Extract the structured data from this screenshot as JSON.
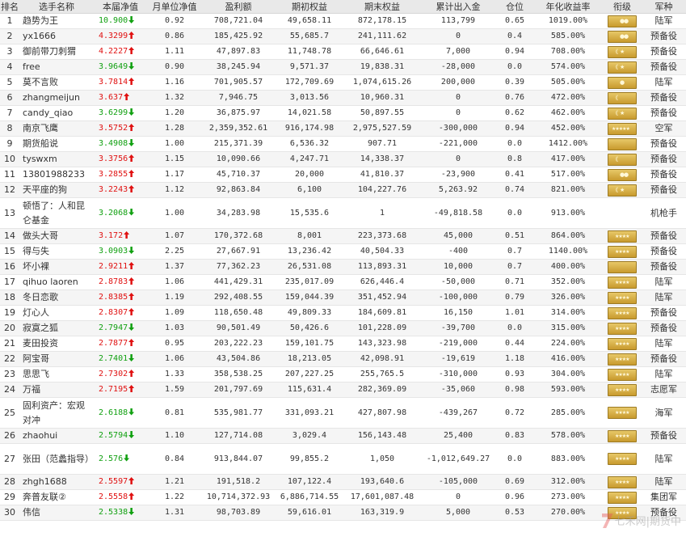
{
  "headers": [
    "排名",
    "选手名称",
    "本届净值",
    "月单位净值",
    "盈利额",
    "期初权益",
    "期末权益",
    "累计出入金",
    "仓位",
    "年化收益率",
    "衔级",
    "军种"
  ],
  "rows": [
    {
      "rank": "1",
      "name": "趋势为王",
      "nav": "10.900",
      "dir": "down",
      "mu": "0.92",
      "profit": "708,721.04",
      "begin": "49,658.11",
      "end": "872,178.15",
      "flow": "113,799",
      "pos": "0.65",
      "annual": "1019.00%",
      "branch": "陆军",
      "insignia": "two-bar-gold-badge"
    },
    {
      "rank": "2",
      "name": "yx1666",
      "nav": "4.3299",
      "dir": "up",
      "mu": "0.86",
      "profit": "185,425.92",
      "begin": "55,685.7",
      "end": "241,111.62",
      "flow": "0",
      "pos": "0.4",
      "annual": "585.00%",
      "branch": "预备役",
      "insignia": "two-bar-gold-badge"
    },
    {
      "rank": "3",
      "name": "御前带刀刺猬",
      "nav": "4.2227",
      "dir": "up",
      "mu": "1.11",
      "profit": "47,897.83",
      "begin": "11,748.78",
      "end": "66,646.61",
      "flow": "7,000",
      "pos": "0.94",
      "annual": "708.00%",
      "branch": "预备役",
      "insignia": "chevron-star-badge"
    },
    {
      "rank": "4",
      "name": "free",
      "nav": "3.9649",
      "dir": "down",
      "mu": "0.90",
      "profit": "38,245.94",
      "begin": "9,571.37",
      "end": "19,838.31",
      "flow": "-28,000",
      "pos": "0.0",
      "annual": "574.00%",
      "branch": "预备役",
      "insignia": "chevron-star-badge"
    },
    {
      "rank": "5",
      "name": "莫不言败",
      "nav": "3.7814",
      "dir": "up",
      "mu": "1.16",
      "profit": "701,905.57",
      "begin": "172,709.69",
      "end": "1,074,615.26",
      "flow": "200,000",
      "pos": "0.39",
      "annual": "505.00%",
      "branch": "陆军",
      "insignia": "one-bar-gold-badge"
    },
    {
      "rank": "6",
      "name": "zhangmeijun",
      "nav": "3.637",
      "dir": "up",
      "mu": "1.32",
      "profit": "7,946.75",
      "begin": "3,013.56",
      "end": "10,960.31",
      "flow": "0",
      "pos": "0.76",
      "annual": "472.00%",
      "branch": "预备役",
      "insignia": "chevron-badge"
    },
    {
      "rank": "7",
      "name": "candy_qiao",
      "nav": "3.6299",
      "dir": "down",
      "mu": "1.20",
      "profit": "36,875.97",
      "begin": "14,021.58",
      "end": "50,897.55",
      "flow": "0",
      "pos": "0.62",
      "annual": "462.00%",
      "branch": "预备役",
      "insignia": "chevron-star-badge"
    },
    {
      "rank": "8",
      "name": "南京飞鹰",
      "nav": "3.5752",
      "dir": "up",
      "mu": "1.28",
      "profit": "2,359,352.61",
      "begin": "916,174.98",
      "end": "2,975,527.59",
      "flow": "-300,000",
      "pos": "0.94",
      "annual": "452.00%",
      "branch": "空军",
      "insignia": "five-star-badge"
    },
    {
      "rank": "9",
      "name": "期货船说",
      "nav": "3.4908",
      "dir": "down",
      "mu": "1.00",
      "profit": "215,371.39",
      "begin": "6,536.32",
      "end": "907.71",
      "flow": "-221,000",
      "pos": "0.0",
      "annual": "1412.00%",
      "branch": "预备役",
      "insignia": "plain-gold-badge"
    },
    {
      "rank": "10",
      "name": "tyswxm",
      "nav": "3.3756",
      "dir": "up",
      "mu": "1.15",
      "profit": "10,090.66",
      "begin": "4,247.71",
      "end": "14,338.37",
      "flow": "0",
      "pos": "0.8",
      "annual": "417.00%",
      "branch": "预备役",
      "insignia": "chevron-badge"
    },
    {
      "rank": "11",
      "name": "13801988233",
      "nav": "3.2855",
      "dir": "up",
      "mu": "1.17",
      "profit": "45,710.37",
      "begin": "20,000",
      "end": "41,810.37",
      "flow": "-23,900",
      "pos": "0.41",
      "annual": "517.00%",
      "branch": "预备役",
      "insignia": "two-bar-gold-badge"
    },
    {
      "rank": "12",
      "name": "天平座的狗",
      "nav": "3.2243",
      "dir": "up",
      "mu": "1.12",
      "profit": "92,863.84",
      "begin": "6,100",
      "end": "104,227.76",
      "flow": "5,263.92",
      "pos": "0.74",
      "annual": "821.00%",
      "branch": "预备役",
      "insignia": "chevron-star-badge"
    },
    {
      "rank": "13",
      "name": "顿悟了：人和昆仑基金",
      "nav": "3.2068",
      "dir": "down",
      "mu": "1.00",
      "profit": "34,283.98",
      "begin": "15,535.6",
      "end": "1",
      "flow": "-49,818.58",
      "pos": "0.0",
      "annual": "913.00%",
      "branch": "机枪手",
      "insignia": "none"
    },
    {
      "rank": "14",
      "name": "做头大哥",
      "nav": "3.172",
      "dir": "up",
      "mu": "1.07",
      "profit": "170,372.68",
      "begin": "8,001",
      "end": "223,373.68",
      "flow": "45,000",
      "pos": "0.51",
      "annual": "864.00%",
      "branch": "预备役",
      "insignia": "four-star-badge"
    },
    {
      "rank": "15",
      "name": "得与失",
      "nav": "3.0903",
      "dir": "down",
      "mu": "2.25",
      "profit": "27,667.91",
      "begin": "13,236.42",
      "end": "40,504.33",
      "flow": "-400",
      "pos": "0.7",
      "annual": "1140.00%",
      "branch": "预备役",
      "insignia": "four-star-badge"
    },
    {
      "rank": "16",
      "name": "坏小裸",
      "nav": "2.9211",
      "dir": "up",
      "mu": "1.37",
      "profit": "77,362.23",
      "begin": "26,531.08",
      "end": "113,893.31",
      "flow": "10,000",
      "pos": "0.7",
      "annual": "400.00%",
      "branch": "预备役",
      "insignia": "plain-gold-badge"
    },
    {
      "rank": "17",
      "name": "qihuo laoren",
      "nav": "2.8783",
      "dir": "up",
      "mu": "1.06",
      "profit": "441,429.31",
      "begin": "235,017.09",
      "end": "626,446.4",
      "flow": "-50,000",
      "pos": "0.71",
      "annual": "352.00%",
      "branch": "陆军",
      "insignia": "four-star-badge"
    },
    {
      "rank": "18",
      "name": "冬日恋歌",
      "nav": "2.8385",
      "dir": "up",
      "mu": "1.19",
      "profit": "292,408.55",
      "begin": "159,044.39",
      "end": "351,452.94",
      "flow": "-100,000",
      "pos": "0.79",
      "annual": "326.00%",
      "branch": "陆军",
      "insignia": "four-star-badge"
    },
    {
      "rank": "19",
      "name": "灯心人",
      "nav": "2.8307",
      "dir": "up",
      "mu": "1.09",
      "profit": "118,650.48",
      "begin": "49,809.33",
      "end": "184,609.81",
      "flow": "16,150",
      "pos": "1.01",
      "annual": "314.00%",
      "branch": "预备役",
      "insignia": "four-star-badge"
    },
    {
      "rank": "20",
      "name": "寂寞之狐",
      "nav": "2.7947",
      "dir": "down",
      "mu": "1.03",
      "profit": "90,501.49",
      "begin": "50,426.6",
      "end": "101,228.09",
      "flow": "-39,700",
      "pos": "0.0",
      "annual": "315.00%",
      "branch": "预备役",
      "insignia": "four-star-badge"
    },
    {
      "rank": "21",
      "name": "麦田投资",
      "nav": "2.7877",
      "dir": "up",
      "mu": "0.95",
      "profit": "203,222.23",
      "begin": "159,101.75",
      "end": "143,323.98",
      "flow": "-219,000",
      "pos": "0.44",
      "annual": "224.00%",
      "branch": "陆军",
      "insignia": "four-star-badge"
    },
    {
      "rank": "22",
      "name": "阿宝哥",
      "nav": "2.7401",
      "dir": "down",
      "mu": "1.06",
      "profit": "43,504.86",
      "begin": "18,213.05",
      "end": "42,098.91",
      "flow": "-19,619",
      "pos": "1.18",
      "annual": "416.00%",
      "branch": "预备役",
      "insignia": "four-star-badge"
    },
    {
      "rank": "23",
      "name": "思思飞",
      "nav": "2.7302",
      "dir": "up",
      "mu": "1.33",
      "profit": "358,538.25",
      "begin": "207,227.25",
      "end": "255,765.5",
      "flow": "-310,000",
      "pos": "0.93",
      "annual": "304.00%",
      "branch": "陆军",
      "insignia": "four-star-badge"
    },
    {
      "rank": "24",
      "name": "万福",
      "nav": "2.7195",
      "dir": "up",
      "mu": "1.59",
      "profit": "201,797.69",
      "begin": "115,631.4",
      "end": "282,369.09",
      "flow": "-35,060",
      "pos": "0.98",
      "annual": "593.00%",
      "branch": "志愿军",
      "insignia": "four-star-badge"
    },
    {
      "rank": "25",
      "name": "固利资产：宏观对冲",
      "nav": "2.6188",
      "dir": "down",
      "mu": "0.81",
      "profit": "535,981.77",
      "begin": "331,093.21",
      "end": "427,807.98",
      "flow": "-439,267",
      "pos": "0.72",
      "annual": "285.00%",
      "branch": "海军",
      "insignia": "four-star-badge"
    },
    {
      "rank": "26",
      "name": "zhaohui",
      "nav": "2.5794",
      "dir": "down",
      "mu": "1.10",
      "profit": "127,714.08",
      "begin": "3,029.4",
      "end": "156,143.48",
      "flow": "25,400",
      "pos": "0.83",
      "annual": "578.00%",
      "branch": "预备役",
      "insignia": "four-star-badge"
    },
    {
      "rank": "27",
      "name": "张田（范蠡指导）",
      "nav": "2.576",
      "dir": "down",
      "mu": "0.84",
      "profit": "913,844.07",
      "begin": "99,855.2",
      "end": "1,050",
      "flow": "-1,012,649.27",
      "pos": "0.0",
      "annual": "883.00%",
      "branch": "陆军",
      "insignia": "four-star-badge"
    },
    {
      "rank": "28",
      "name": "zhgh1688",
      "nav": "2.5597",
      "dir": "up",
      "mu": "1.21",
      "profit": "191,518.2",
      "begin": "107,122.4",
      "end": "193,640.6",
      "flow": "-105,000",
      "pos": "0.69",
      "annual": "312.00%",
      "branch": "陆军",
      "insignia": "four-star-badge"
    },
    {
      "rank": "29",
      "name": "奔普友联②",
      "nav": "2.5558",
      "dir": "up",
      "mu": "1.22",
      "profit": "10,714,372.93",
      "begin": "6,886,714.55",
      "end": "17,601,087.48",
      "flow": "0",
      "pos": "0.96",
      "annual": "273.00%",
      "branch": "集团军",
      "insignia": "four-star-badge"
    },
    {
      "rank": "30",
      "name": "伟信",
      "nav": "2.5338",
      "dir": "down",
      "mu": "1.31",
      "profit": "98,703.89",
      "begin": "59,616.01",
      "end": "163,319.9",
      "flow": "5,000",
      "pos": "0.53",
      "annual": "270.00%",
      "branch": "预备役",
      "insignia": "four-star-badge"
    }
  ],
  "watermark": "七禾网|期货中"
}
